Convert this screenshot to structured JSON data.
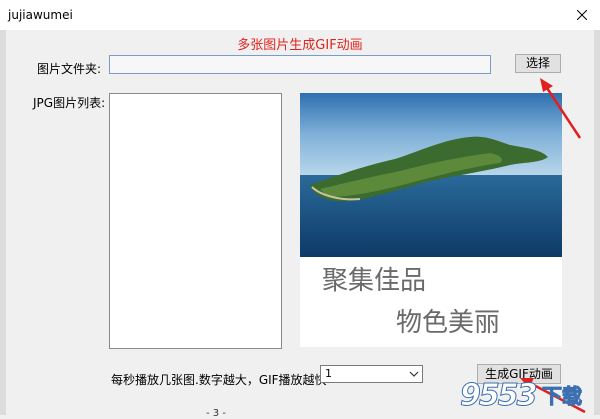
{
  "window": {
    "title": "jujiawumei"
  },
  "header": {
    "title": "多张图片生成GIF动画"
  },
  "folder": {
    "label": "图片文件夹:",
    "value": "",
    "button_label": "选择"
  },
  "list": {
    "label": "JPG图片列表:"
  },
  "preview": {
    "calligraphy_line1": "聚集佳品",
    "calligraphy_line2": "物色美丽"
  },
  "speed": {
    "label": "每秒播放几张图.数字越大，GIF播放越快",
    "value": "1"
  },
  "generate": {
    "button_label": "生成GIF动画"
  },
  "watermark": {
    "number": "9553",
    "suffix": "下载"
  },
  "background": {
    "fragment": "- 3 -"
  },
  "colors": {
    "heading": "#e0231c",
    "annotation_arrow": "#e02020"
  }
}
